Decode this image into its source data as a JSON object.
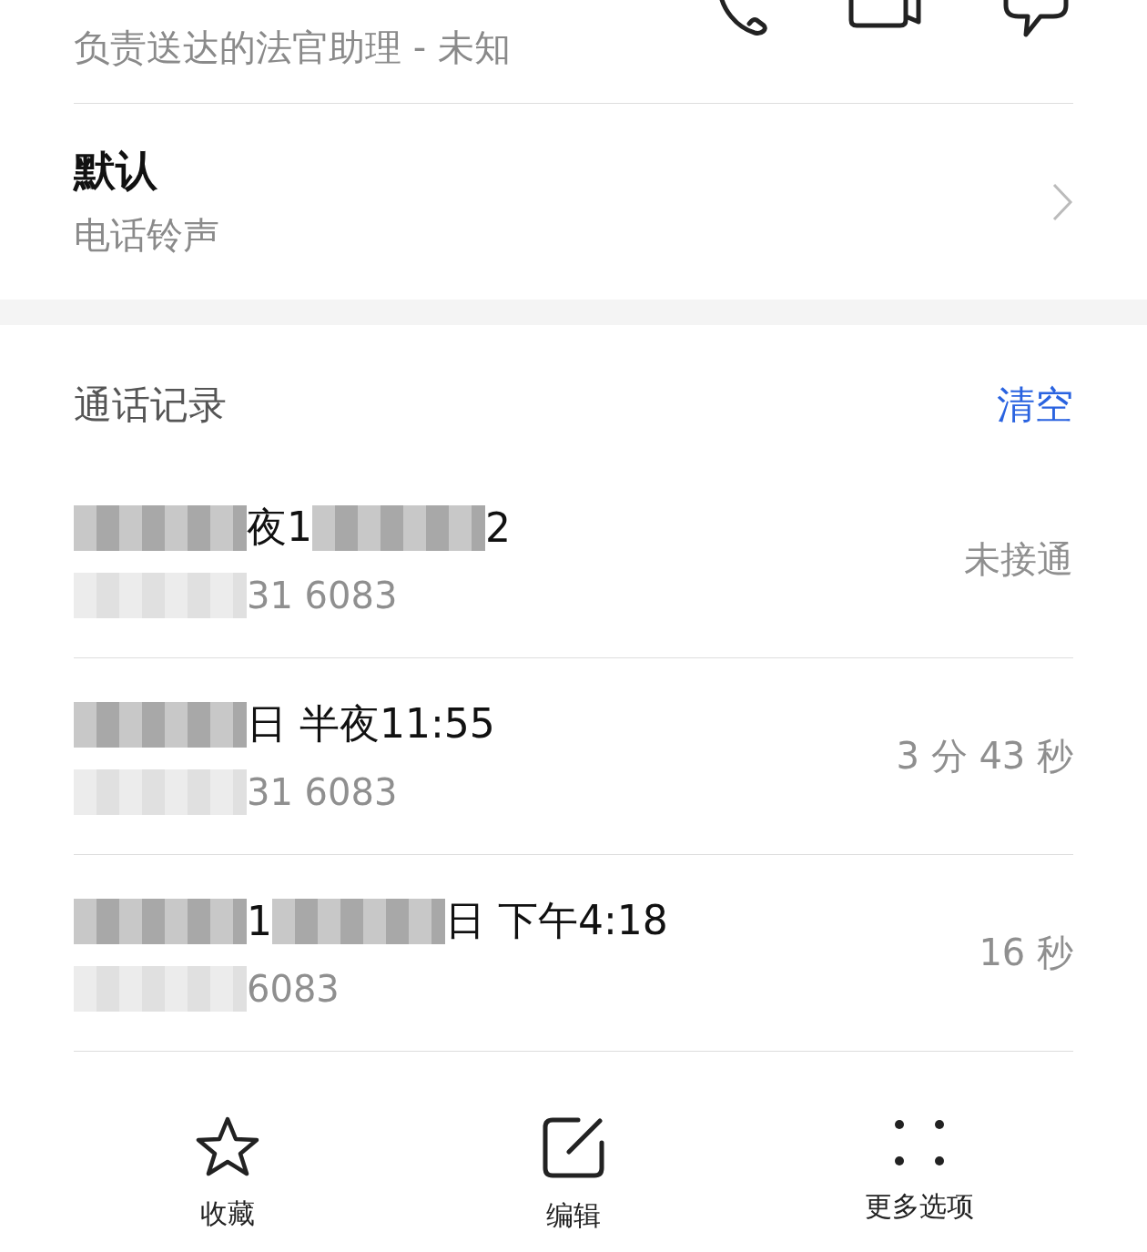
{
  "contact": {
    "subtitle": "负责送达的法官助理 - 未知"
  },
  "ringtone": {
    "title": "默认",
    "subtitle": "电话铃声"
  },
  "call_log": {
    "title": "通话记录",
    "clear": "清空",
    "rows": [
      {
        "title": [
          {
            "kind": "redacted"
          },
          {
            "kind": "text",
            "text": "夜1"
          },
          {
            "kind": "redacted"
          },
          {
            "kind": "text",
            "text": "2"
          }
        ],
        "number": [
          {
            "kind": "redacted"
          },
          {
            "kind": "text",
            "text": "31 6083"
          }
        ],
        "status": "未接通"
      },
      {
        "title": [
          {
            "kind": "redacted"
          },
          {
            "kind": "text",
            "text": "日 半夜11:55"
          }
        ],
        "number": [
          {
            "kind": "redacted"
          },
          {
            "kind": "text",
            "text": "31 6083"
          }
        ],
        "status": "3 分 43 秒"
      },
      {
        "title": [
          {
            "kind": "redacted"
          },
          {
            "kind": "text",
            "text": "1"
          },
          {
            "kind": "redacted"
          },
          {
            "kind": "text",
            "text": "日 下午4:18"
          }
        ],
        "number": [
          {
            "kind": "redacted"
          },
          {
            "kind": "text",
            "text": "6083"
          }
        ],
        "status": "16 秒"
      }
    ]
  },
  "bottom_bar": [
    {
      "kind": "star",
      "label": "收藏"
    },
    {
      "kind": "edit",
      "label": "编辑"
    },
    {
      "kind": "more",
      "label": "更多选项"
    }
  ]
}
